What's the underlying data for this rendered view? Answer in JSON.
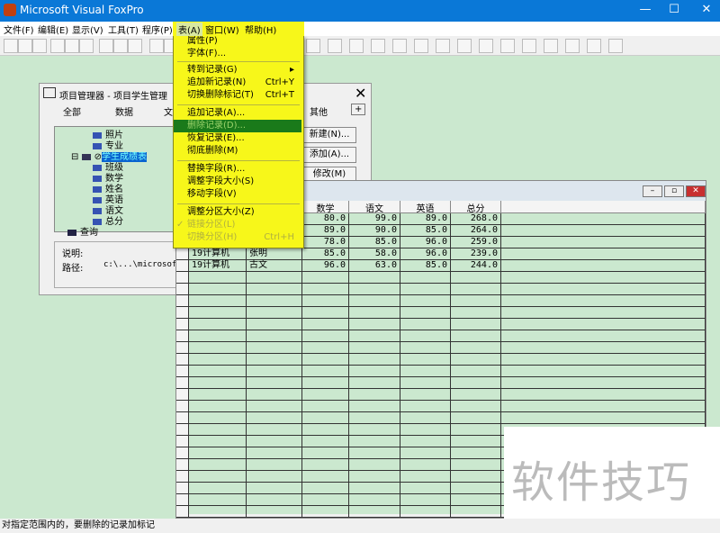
{
  "app": {
    "title": "Microsoft Visual FoxPro"
  },
  "menubar": [
    "文件(F)",
    "编辑(E)",
    "显示(V)",
    "工具(T)",
    "程序(P)",
    "表(A)",
    "窗口(W)",
    "帮助(H)"
  ],
  "table_menu": {
    "items": [
      {
        "label": "属性(P)"
      },
      {
        "label": "字体(F)..."
      },
      {
        "label": "转到记录(G)",
        "submenu": true
      },
      {
        "label": "追加新记录(N)",
        "shortcut": "Ctrl+Y"
      },
      {
        "label": "切换删除标记(T)",
        "shortcut": "Ctrl+T"
      },
      {
        "label": "追加记录(A)..."
      },
      {
        "label": "删除记录(D)...",
        "selected": true
      },
      {
        "label": "恢复记录(E)..."
      },
      {
        "label": "彻底删除(M)"
      },
      {
        "label": "替换字段(R)..."
      },
      {
        "label": "调整字段大小(S)"
      },
      {
        "label": "移动字段(V)"
      },
      {
        "label": "调整分区大小(Z)"
      },
      {
        "label": "链接分区(L)",
        "checked": true,
        "disabled": true
      },
      {
        "label": "切换分区(H)",
        "shortcut": "Ctrl+H",
        "disabled": true
      }
    ]
  },
  "project": {
    "title": "项目管理器 - 项目学生管理",
    "tabs": [
      "全部",
      "数据",
      "文",
      "其他",
      "+"
    ],
    "tree": [
      "照片",
      "专业",
      "学生成绩表",
      "班级",
      "数学",
      "姓名",
      "英语",
      "语文",
      "总分",
      "查询"
    ],
    "buttons": [
      "新建(N)...",
      "添加(A)...",
      "修改(M)"
    ],
    "desc_label": "说明:",
    "path_label": "路径:",
    "path_value": "c:\\...\\microsoft v"
  },
  "browse": {
    "headers": [
      "数学",
      "语文",
      "英语",
      "总分"
    ],
    "rows": [
      {
        "c1": "",
        "c2": "",
        "v": [
          "80.0",
          "99.0",
          "89.0",
          "268.0"
        ]
      },
      {
        "c1": "",
        "c2": "",
        "v": [
          "89.0",
          "90.0",
          "85.0",
          "264.0"
        ]
      },
      {
        "c1": "",
        "c2": "",
        "v": [
          "78.0",
          "85.0",
          "96.0",
          "259.0"
        ]
      },
      {
        "c1": "19计算机",
        "c2": "张明",
        "v": [
          "85.0",
          "58.0",
          "96.0",
          "239.0"
        ]
      },
      {
        "c1": "19计算机",
        "c2": "古文",
        "v": [
          "96.0",
          "63.0",
          "85.0",
          "244.0"
        ]
      }
    ]
  },
  "status": "对指定范围内的，要删除的记录加标记",
  "watermark": "软件技巧"
}
